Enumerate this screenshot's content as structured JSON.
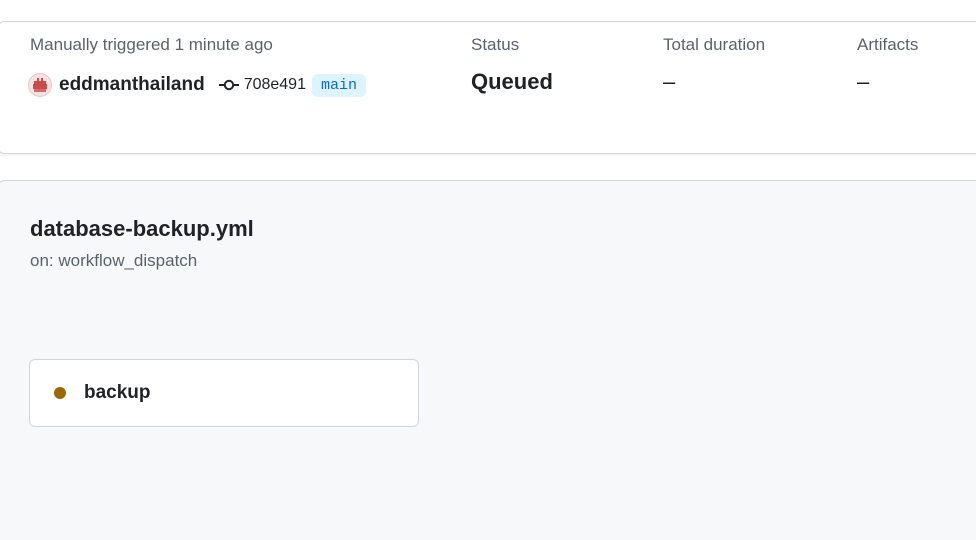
{
  "summary": {
    "trigger_label": "Manually triggered 1 minute ago",
    "actor": "eddmanthailand",
    "commit_sha": "708e491",
    "branch": "main",
    "status_label": "Status",
    "status_value": "Queued",
    "duration_label": "Total duration",
    "duration_value": "–",
    "artifacts_label": "Artifacts",
    "artifacts_value": "–"
  },
  "workflow": {
    "file_name": "database-backup.yml",
    "trigger": "on: workflow_dispatch"
  },
  "jobs": [
    {
      "name": "backup",
      "status": "queued",
      "status_color": "#9a6700",
      "icon": "queued-dot-icon"
    }
  ],
  "colors": {
    "branch_badge_bg": "#ddf4ff",
    "branch_badge_text": "#0969da",
    "panel_bg": "#f6f8fa",
    "border": "#d0d7de"
  }
}
